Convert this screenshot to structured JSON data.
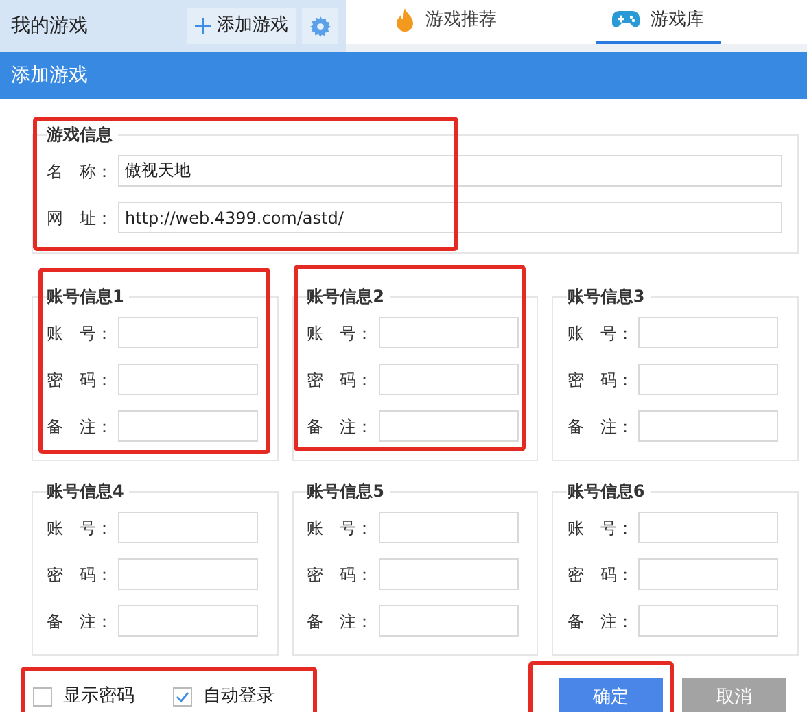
{
  "header": {
    "title": "我的游戏",
    "add_button": "添加游戏",
    "tabs": [
      {
        "label": "游戏推荐",
        "selected": false
      },
      {
        "label": "游戏库",
        "selected": true
      }
    ]
  },
  "dialog": {
    "title": "添加游戏",
    "game_info": {
      "legend": "游戏信息",
      "fields": [
        {
          "label": "名　称：",
          "value": "傲视天地"
        },
        {
          "label": "网　址：",
          "value": "http://web.4399.com/astd/"
        }
      ]
    },
    "accounts": [
      {
        "legend": "账号信息1",
        "fields": [
          "账　号：",
          "密　码：",
          "备　注："
        ]
      },
      {
        "legend": "账号信息2",
        "fields": [
          "账　号：",
          "密　码：",
          "备　注："
        ]
      },
      {
        "legend": "账号信息3",
        "fields": [
          "账　号：",
          "密　码：",
          "备　注："
        ]
      },
      {
        "legend": "账号信息4",
        "fields": [
          "账　号：",
          "密　码：",
          "备　注："
        ]
      },
      {
        "legend": "账号信息5",
        "fields": [
          "账　号：",
          "密　码：",
          "备　注："
        ]
      },
      {
        "legend": "账号信息6",
        "fields": [
          "账　号：",
          "密　码：",
          "备　注："
        ]
      }
    ],
    "options": [
      {
        "label": "显示密码",
        "checked": false
      },
      {
        "label": "自动登录",
        "checked": true
      }
    ],
    "buttons": [
      {
        "label": "确定",
        "kind": "primary"
      },
      {
        "label": "取消",
        "kind": "secondary"
      }
    ]
  }
}
